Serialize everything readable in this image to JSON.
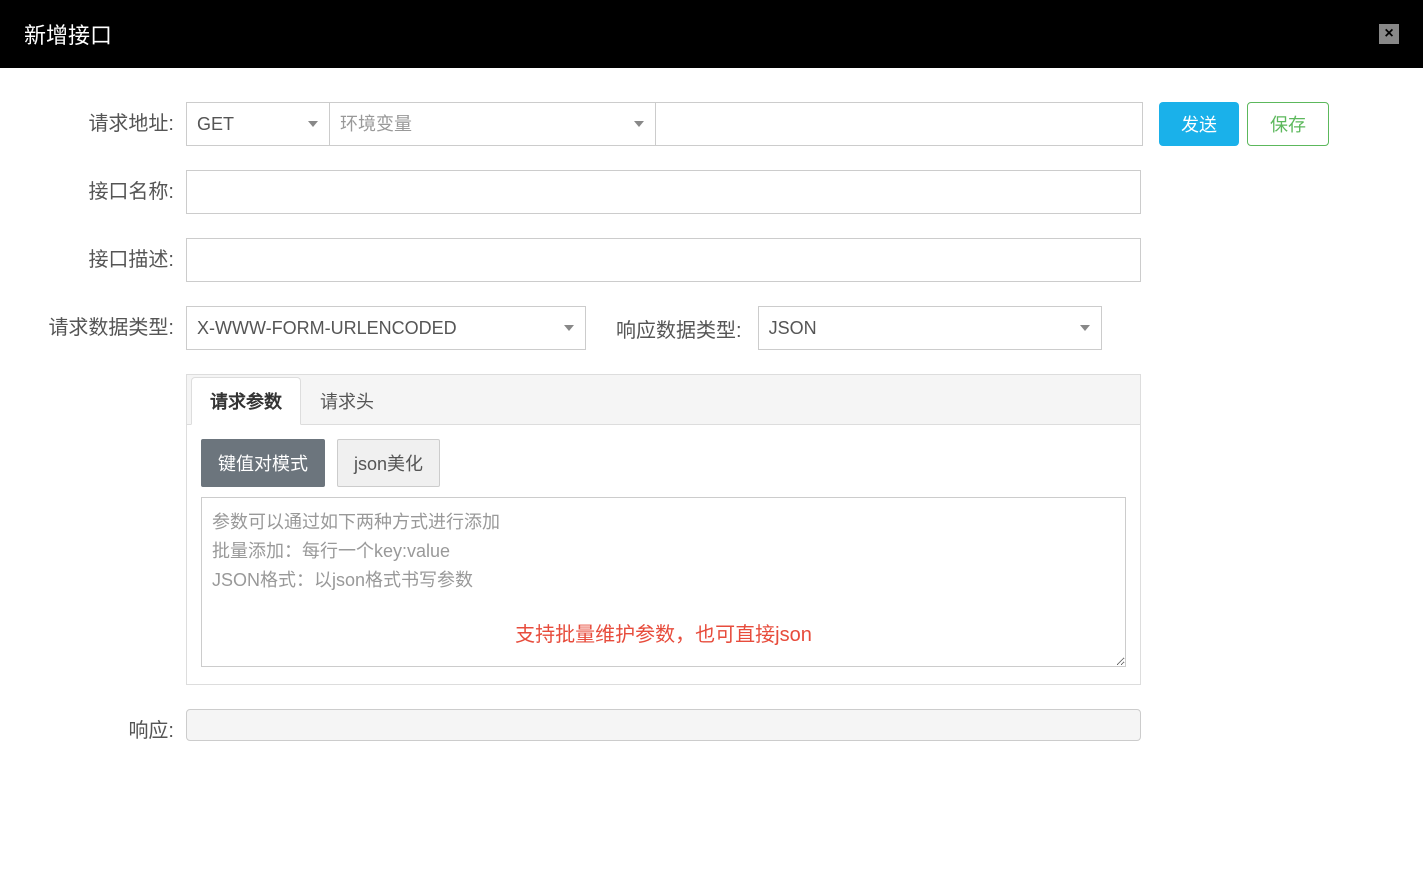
{
  "header": {
    "title": "新增接口",
    "close_label": "×"
  },
  "form": {
    "url_label": "请求地址:",
    "method_value": "GET",
    "env_placeholder": "环境变量",
    "send_label": "发送",
    "save_label": "保存",
    "name_label": "接口名称:",
    "desc_label": "接口描述:",
    "reqtype_label": "请求数据类型:",
    "reqtype_value": "X-WWW-FORM-URLENCODED",
    "restype_label": "响应数据类型:",
    "restype_value": "JSON",
    "response_label": "响应:"
  },
  "tabs": {
    "params_label": "请求参数",
    "headers_label": "请求头"
  },
  "params": {
    "kv_mode_label": "键值对模式",
    "json_beautify_label": "json美化",
    "placeholder": "参数可以通过如下两种方式进行添加\n批量添加：每行一个key:value\nJSON格式：以json格式书写参数",
    "hint": "支持批量维护参数，也可直接json"
  }
}
